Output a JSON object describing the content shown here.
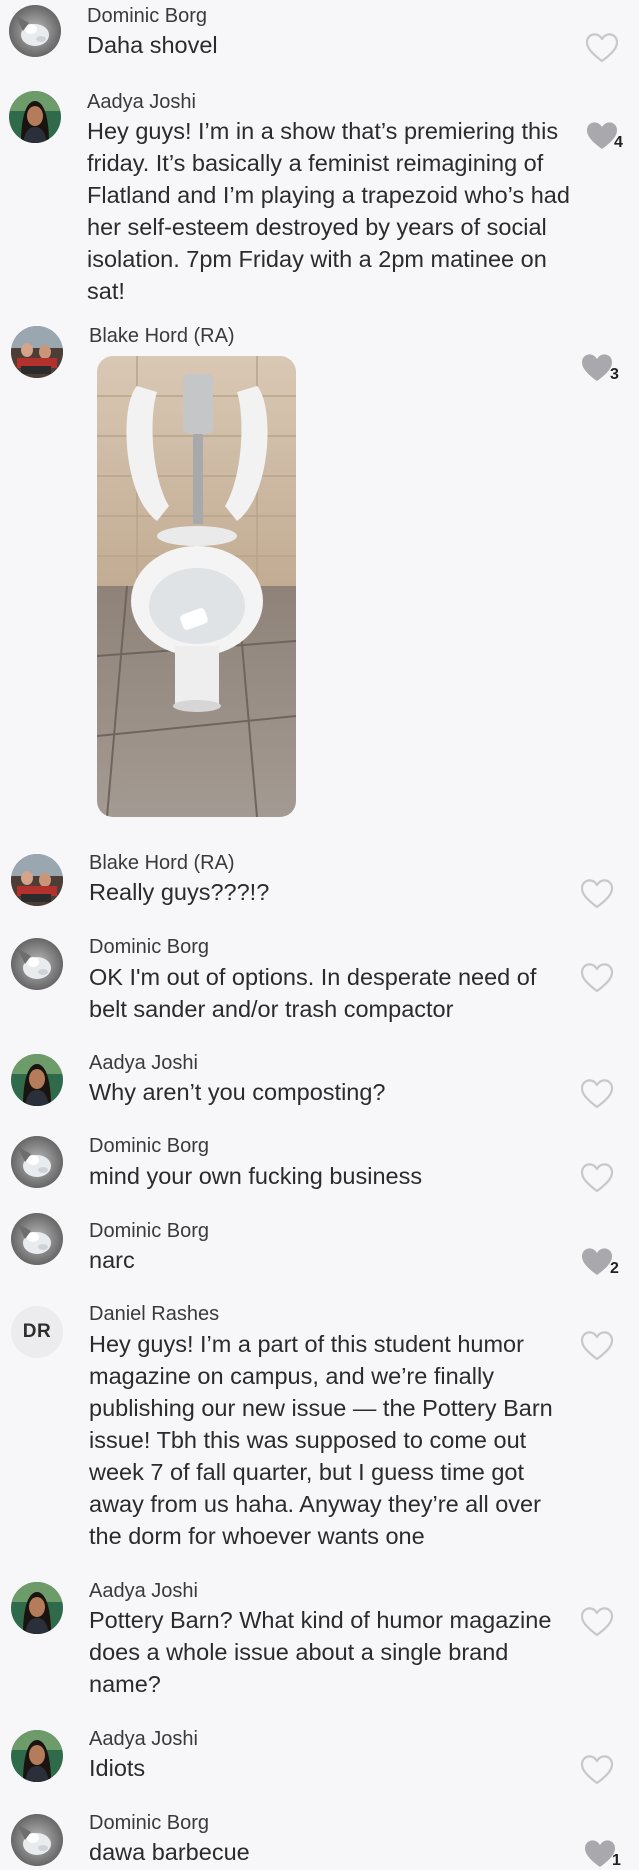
{
  "messages": [
    {
      "author": "Dominic Borg",
      "text": "Daha shovel",
      "liked": false,
      "likes": ""
    },
    {
      "author": "Aadya Joshi",
      "text": "Hey guys! I’m in a show that’s premiering this friday. It’s basically a feminist reimagining of Flatland and I’m playing a trapezoid who’s had her self-esteem destroyed by years of social isolation. 7pm Friday with a 2pm matinee on sat!",
      "liked": true,
      "likes": "4"
    },
    {
      "author": "Blake Hord (RA)",
      "text": "",
      "liked": true,
      "likes": "3"
    },
    {
      "author": "Blake Hord (RA)",
      "text": "Really guys???!?",
      "liked": false,
      "likes": ""
    },
    {
      "author": "Dominic Borg",
      "text": "OK I'm out of options. In desperate need of belt sander and/or trash compactor",
      "liked": false,
      "likes": ""
    },
    {
      "author": "Aadya Joshi",
      "text": "Why aren’t you composting?",
      "liked": false,
      "likes": ""
    },
    {
      "author": "Dominic Borg",
      "text": "mind your own fucking business",
      "liked": false,
      "likes": ""
    },
    {
      "author": "Dominic Borg",
      "text": "narc",
      "liked": true,
      "likes": "2"
    },
    {
      "author": "Daniel Rashes",
      "initials": "DR",
      "text": "Hey guys! I’m a part of this student humor magazine on campus, and we’re finally publishing our new issue — the Pottery Barn issue! Tbh this was supposed to come out week 7 of fall quarter, but I guess time got away from us haha. Anyway they’re all over the dorm for whoever wants one",
      "liked": false,
      "likes": ""
    },
    {
      "author": "Aadya Joshi",
      "text": "Pottery Barn? What kind of humor magazine does a whole issue about a single brand name?",
      "liked": false,
      "likes": ""
    },
    {
      "author": "Aadya Joshi",
      "text": "Idiots",
      "liked": false,
      "likes": ""
    },
    {
      "author": "Dominic Borg",
      "text": "dawa barbecue",
      "liked": true,
      "likes": "1"
    }
  ],
  "colors": {
    "background": "#f7f7f9",
    "heart_outline": "#c8c8cc",
    "heart_filled": "#a9a9ad"
  },
  "icons": {
    "heart": "heart-icon"
  }
}
